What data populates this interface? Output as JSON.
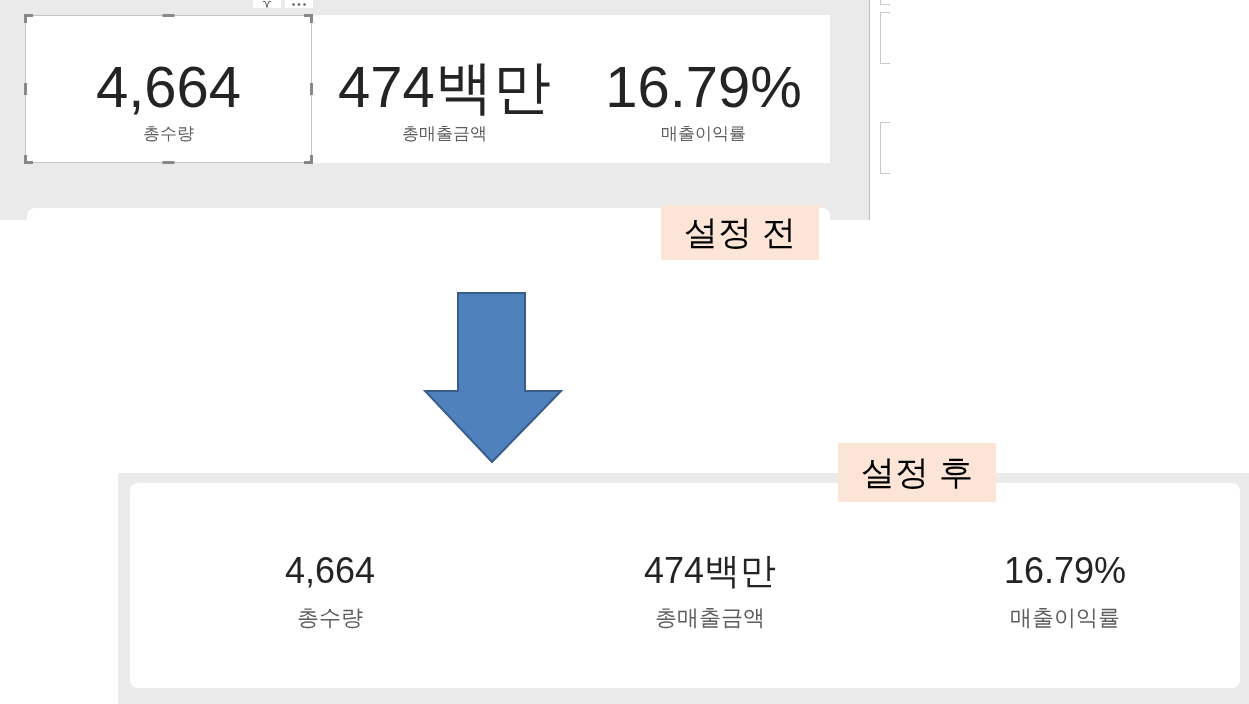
{
  "before": {
    "cards": [
      {
        "value": "4,664",
        "label": "총수량",
        "selected": true
      },
      {
        "value": "474백만",
        "label": "총매출금액",
        "selected": false
      },
      {
        "value": "16.79%",
        "label": "매출이익률",
        "selected": false
      }
    ],
    "caption": "설정 전"
  },
  "after": {
    "caption": "설정 후",
    "cards": [
      {
        "value": "4,664",
        "label": "총수량",
        "selected": false
      },
      {
        "value": "474백만",
        "label": "총매출금액",
        "selected": false
      },
      {
        "value": "16.79%",
        "label": "매출이익률",
        "selected": false
      }
    ]
  }
}
